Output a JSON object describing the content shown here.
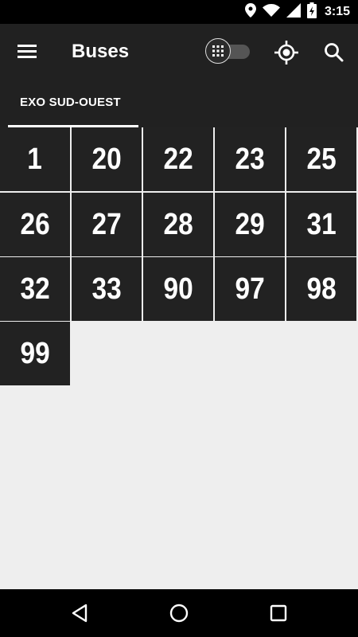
{
  "status_bar": {
    "time": "3:15",
    "icons": [
      "location-icon",
      "wifi-icon",
      "signal-icon",
      "battery-charging-icon"
    ]
  },
  "app_bar": {
    "title": "Buses",
    "icons": [
      "menu-icon",
      "grid-view-toggle-icon",
      "my-location-icon",
      "search-icon"
    ]
  },
  "tabs": [
    {
      "label": "EXO SUD-OUEST",
      "selected": true
    }
  ],
  "routes": [
    "1",
    "20",
    "22",
    "23",
    "25",
    "26",
    "27",
    "28",
    "29",
    "31",
    "32",
    "33",
    "90",
    "97",
    "98",
    "99"
  ],
  "nav_bar": {
    "icons": [
      "back-icon",
      "home-icon",
      "recents-icon"
    ]
  },
  "colors": {
    "app_bar": "#212121",
    "tile": "#222222",
    "background": "#eeeeee",
    "status_bar": "#000000"
  }
}
